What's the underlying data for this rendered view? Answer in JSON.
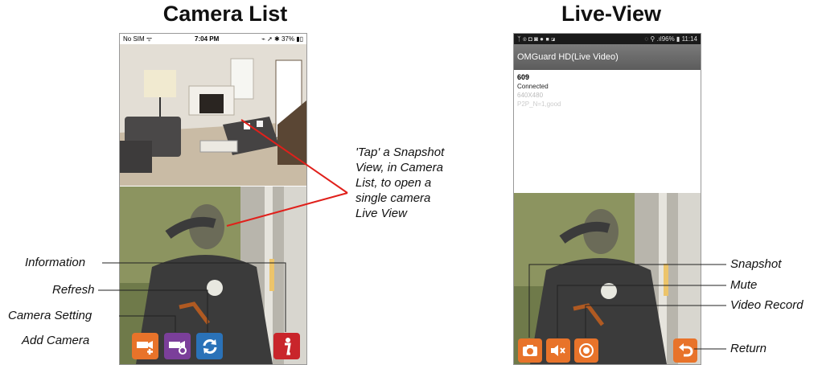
{
  "headings": {
    "left": "Camera List",
    "right": "Live-View"
  },
  "camera_list_phone": {
    "status": {
      "carrier": "No SIM",
      "time": "7:04 PM",
      "battery": "37%"
    },
    "toolbar": [
      "add-camera-icon",
      "camera-setting-icon",
      "refresh-icon",
      "information-icon"
    ]
  },
  "live_view_phone": {
    "status": {
      "time": "11:14",
      "signal": "96%"
    },
    "title": "OMGuard HD(Live Video)",
    "camera_name": "609",
    "connection": "Connected",
    "resolution": "640X480",
    "p2p": "P2P_N=1,good",
    "toolbar": [
      "snapshot-icon",
      "mute-icon",
      "record-icon",
      "return-icon"
    ]
  },
  "callouts": {
    "tap_note": "'Tap' a Snapshot\nView, in Camera\nList, to open a\nsingle camera\nLive View",
    "information": "Information",
    "refresh": "Refresh",
    "camera_setting": "Camera Setting",
    "add_camera": "Add Camera",
    "snapshot": "Snapshot",
    "mute": "Mute",
    "video_record": "Video Record",
    "return": "Return"
  },
  "colors": {
    "orange": "#e8732a",
    "purple": "#7b3f9a",
    "blue": "#2a72b8",
    "red": "#c9252b"
  }
}
